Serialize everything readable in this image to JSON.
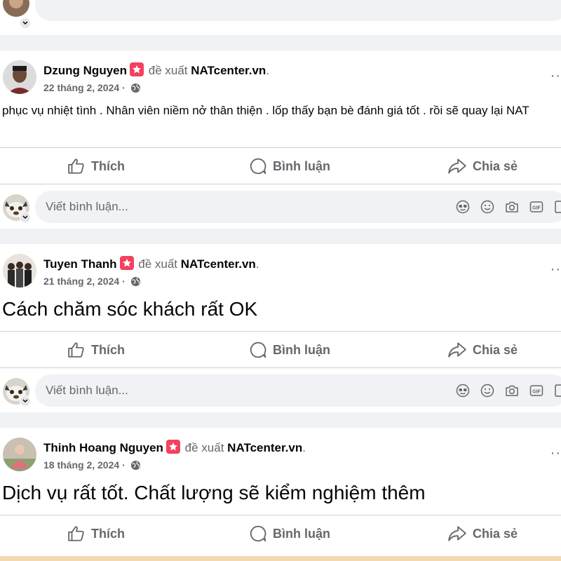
{
  "top_comment_placeholder": "",
  "posts": [
    {
      "author": "Dzung Nguyen",
      "recommends_label": "đề xuất",
      "page": "NATcenter.vn",
      "date": "22 tháng 2, 2024",
      "separator": "·",
      "text": "phục vụ nhiệt tình . Nhân viên niềm nở thân thiện . lốp thấy bạn bè đánh giá tốt . rồi sẽ quay lại NAT",
      "text_size": "small",
      "avatar_color": "#6a6a6a"
    },
    {
      "author": "Tuyen Thanh",
      "recommends_label": "đề xuất",
      "page": "NATcenter.vn",
      "date": "21 tháng 2, 2024",
      "separator": "·",
      "text": "Cách chăm sóc khách rất OK",
      "text_size": "big",
      "avatar_color": "#8a8478"
    },
    {
      "author": "Thinh Hoang Nguyen",
      "recommends_label": "đề xuất",
      "page": "NATcenter.vn",
      "date": "18 tháng 2, 2024",
      "separator": "·",
      "text": "Dịch vụ rất tốt. Chất lượng sẽ kiểm nghiệm thêm",
      "text_size": "big",
      "avatar_color": "#b9a58f"
    }
  ],
  "actions": {
    "like": "Thích",
    "comment": "Bình luận",
    "share": "Chia sẻ"
  },
  "comment_box": {
    "placeholder": "Viết bình luận..."
  },
  "icons": {
    "like": "thumbs-up-icon",
    "comment": "speech-bubble-icon",
    "share": "share-arrow-icon",
    "avatar_sticker": "avatar-sticker-icon",
    "emoji": "emoji-icon",
    "camera": "camera-icon",
    "gif": "gif-icon",
    "sticker": "sticker-icon",
    "globe": "globe-icon",
    "recommend": "recommend-star-icon",
    "more": "more-options-icon"
  },
  "colors": {
    "background": "#f0f2f5",
    "card": "#ffffff",
    "recommend_badge": "#f3425f",
    "secondary_text": "#65676b"
  }
}
